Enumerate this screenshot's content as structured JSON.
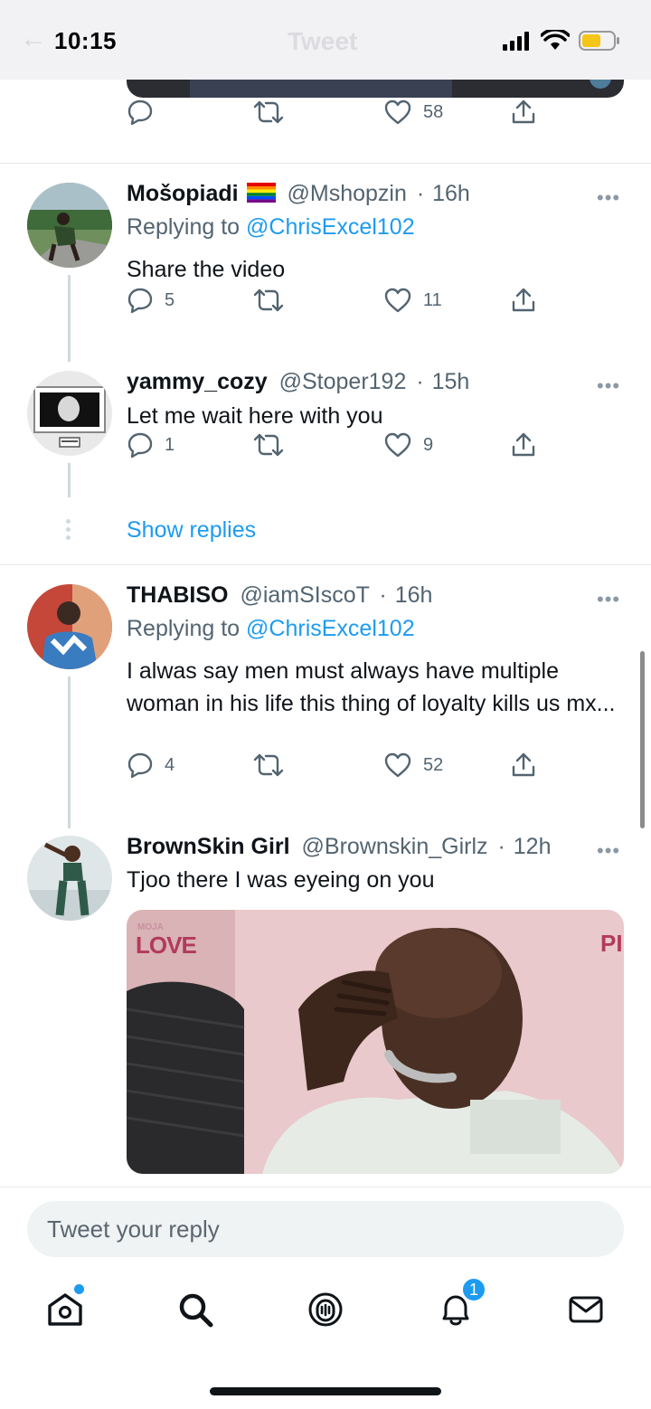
{
  "status_bar": {
    "time": "10:15",
    "header_title": "Tweet",
    "icons": [
      "signal-icon",
      "wifi-icon",
      "battery-icon"
    ]
  },
  "top_tweet": {
    "like_count": "58"
  },
  "replies": [
    {
      "name": "Mošopiadi",
      "flag_icon": "rainbow-flag-icon",
      "handle": "@Mshopzin",
      "time": "16h",
      "replying_prefix": "Replying to",
      "replying_to": "@ChrisExcel102",
      "text": "Share the video",
      "reply_count": "5",
      "retweet_count": "",
      "like_count": "11"
    },
    {
      "name": "yammy_cozy",
      "handle": "@Stoper192",
      "time": "15h",
      "text": "Let me wait here with you",
      "reply_count": "1",
      "retweet_count": "",
      "like_count": "9"
    },
    {
      "name": "THABISO",
      "handle": "@iamSIscoT",
      "time": "16h",
      "replying_prefix": "Replying to",
      "replying_to": "@ChrisExcel102",
      "text": "I alwas say men must always have multiple woman in his life this thing of loyalty kills us mx...",
      "reply_count": "4",
      "retweet_count": "",
      "like_count": "52"
    },
    {
      "name": "BrownSkin Girl",
      "handle": "@Brownskin_Girlz",
      "time": "12h",
      "text": "Tjoo there I was eyeing on you",
      "media_watermark_left": "MOJA",
      "media_watermark_main": "LOVE",
      "media_watermark_right": "PI"
    }
  ],
  "show_replies_label": "Show replies",
  "separator": "·",
  "more_glyph": "•••",
  "reply_input": {
    "placeholder": "Tweet your reply"
  },
  "tabbar": {
    "notification_badge": "1",
    "tabs": [
      "home-icon",
      "search-icon",
      "spaces-icon",
      "notifications-icon",
      "messages-icon"
    ]
  },
  "colors": {
    "accent": "#1d9bf0",
    "text_primary": "#0f1419",
    "text_secondary": "#536471",
    "thread_line": "#cfd9de"
  }
}
